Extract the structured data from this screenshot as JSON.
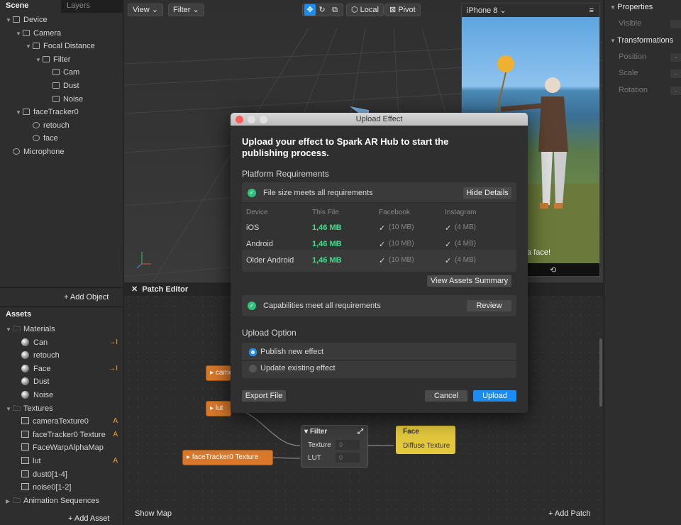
{
  "scene_panel": {
    "tabs": [
      "Scene",
      "Layers"
    ],
    "tree": [
      {
        "label": "Device",
        "depth": 0,
        "icon": "device-icon",
        "expanded": true
      },
      {
        "label": "Camera",
        "depth": 1,
        "icon": "camera-icon",
        "expanded": true
      },
      {
        "label": "Focal Distance",
        "depth": 2,
        "icon": "focal-distance-icon",
        "expanded": true
      },
      {
        "label": "Filter",
        "depth": 3,
        "icon": "filter-icon",
        "expanded": true
      },
      {
        "label": "Cam",
        "depth": 4,
        "icon": "rectangle-icon"
      },
      {
        "label": "Dust",
        "depth": 4,
        "icon": "rectangle-icon"
      },
      {
        "label": "Noise",
        "depth": 4,
        "icon": "rectangle-icon"
      },
      {
        "label": "faceTracker0",
        "depth": 1,
        "icon": "face-tracker-icon",
        "expanded": true
      },
      {
        "label": "retouch",
        "depth": 2,
        "icon": "face-mesh-icon"
      },
      {
        "label": "face",
        "depth": 2,
        "icon": "face-mesh-icon"
      },
      {
        "label": "Microphone",
        "depth": 0,
        "icon": "microphone-icon"
      }
    ],
    "add_object": "Add Object"
  },
  "assets_panel": {
    "title": "Assets",
    "groups": [
      {
        "label": "Materials",
        "items": [
          {
            "label": "Can",
            "tag": "→I"
          },
          {
            "label": "retouch",
            "tag": ""
          },
          {
            "label": "Face",
            "tag": "→I"
          },
          {
            "label": "Dust",
            "tag": ""
          },
          {
            "label": "Noise",
            "tag": ""
          }
        ]
      },
      {
        "label": "Textures",
        "items": [
          {
            "label": "cameraTexture0",
            "tag": "A"
          },
          {
            "label": "faceTracker0 Texture",
            "tag": "A"
          },
          {
            "label": "FaceWarpAlphaMap",
            "tag": ""
          },
          {
            "label": "lut",
            "tag": "A"
          },
          {
            "label": "dust0[1-4]",
            "tag": ""
          },
          {
            "label": "noise0[1-2]",
            "tag": ""
          }
        ]
      },
      {
        "label": "Animation Sequences",
        "items": []
      }
    ],
    "add_asset": "Add Asset"
  },
  "viewport_toolbar": {
    "view": "View",
    "filter": "Filter",
    "local": "Local",
    "pivot": "Pivot"
  },
  "preview": {
    "device": "iPhone 8",
    "caption": "a face!"
  },
  "properties_panel": {
    "properties": "Properties",
    "visible": "Visible",
    "transformations": "Transformations",
    "position": "Position",
    "scale": "Scale",
    "rotation": "Rotation",
    "dash": "-"
  },
  "patch_editor": {
    "title": "Patch Editor",
    "show_map": "Show Map",
    "add_patch": "Add Patch",
    "nodes": {
      "camera": "came",
      "lut": "lut",
      "face_tracker": "faceTracker0 Texture",
      "filter_title": "Filter",
      "filter_texture": "Texture",
      "filter_lut": "LUT",
      "filter_texture_val": "0",
      "filter_lut_val": "0",
      "face_title": "Face",
      "face_port": "Diffuse Texture"
    }
  },
  "modal": {
    "window_title": "Upload Effect",
    "heading": "Upload your effect to Spark AR Hub to start the publishing process.",
    "platform_requirements": "Platform Requirements",
    "file_size_status": "File size meets all requirements",
    "hide_details": "Hide Details",
    "table": {
      "headers": [
        "Device",
        "This File",
        "Facebook",
        "Instagram"
      ],
      "rows": [
        {
          "device": "iOS",
          "file": "1,46 MB",
          "facebook": "(10 MB)",
          "instagram": "(4 MB)"
        },
        {
          "device": "Android",
          "file": "1,46 MB",
          "facebook": "(10 MB)",
          "instagram": "(4 MB)"
        },
        {
          "device": "Older Android",
          "file": "1,46 MB",
          "facebook": "(10 MB)",
          "instagram": "(4 MB)"
        }
      ]
    },
    "view_assets_summary": "View Assets Summary",
    "capabilities_status": "Capabilities meet all requirements",
    "review": "Review",
    "upload_option": "Upload Option",
    "option_publish": "Publish new effect",
    "option_update": "Update existing effect",
    "export_file": "Export File",
    "cancel": "Cancel",
    "upload": "Upload",
    "check_mark": "✓"
  },
  "colors": {
    "accent_blue": "#1b8df0",
    "success_green": "#2ec47d",
    "patch_orange": "#d9782a",
    "patch_yellow": "#e3c83c"
  }
}
